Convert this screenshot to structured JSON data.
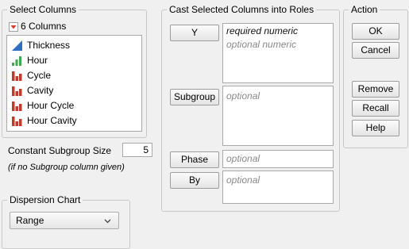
{
  "select_columns": {
    "title": "Select Columns",
    "count_label": "6 Columns",
    "columns": [
      {
        "name": "Thickness",
        "icon": "continuous-icon"
      },
      {
        "name": "Hour",
        "icon": "ordinal-icon"
      },
      {
        "name": "Cycle",
        "icon": "nominal-icon"
      },
      {
        "name": "Cavity",
        "icon": "nominal-icon"
      },
      {
        "name": "Hour Cycle",
        "icon": "nominal-icon"
      },
      {
        "name": "Hour Cavity",
        "icon": "nominal-icon"
      }
    ]
  },
  "subgroup_size": {
    "label": "Constant Subgroup Size",
    "value": "5",
    "note": "(if no Subgroup column given)"
  },
  "dispersion": {
    "title": "Dispersion Chart",
    "selected": "Range"
  },
  "roles": {
    "title": "Cast Selected Columns into Roles",
    "y_label": "Y",
    "y_required": "required numeric",
    "y_optional": "optional numeric",
    "subgroup_label": "Subgroup",
    "subgroup_hint": "optional",
    "phase_label": "Phase",
    "phase_hint": "optional",
    "by_label": "By",
    "by_hint": "optional"
  },
  "action": {
    "title": "Action",
    "ok": "OK",
    "cancel": "Cancel",
    "remove": "Remove",
    "recall": "Recall",
    "help": "Help"
  },
  "colors": {
    "continuous": "#2f6fc0",
    "ordinal": "#3fa84b",
    "nominal": "#c0392b",
    "dropdown_marker": "#d93a2b"
  }
}
